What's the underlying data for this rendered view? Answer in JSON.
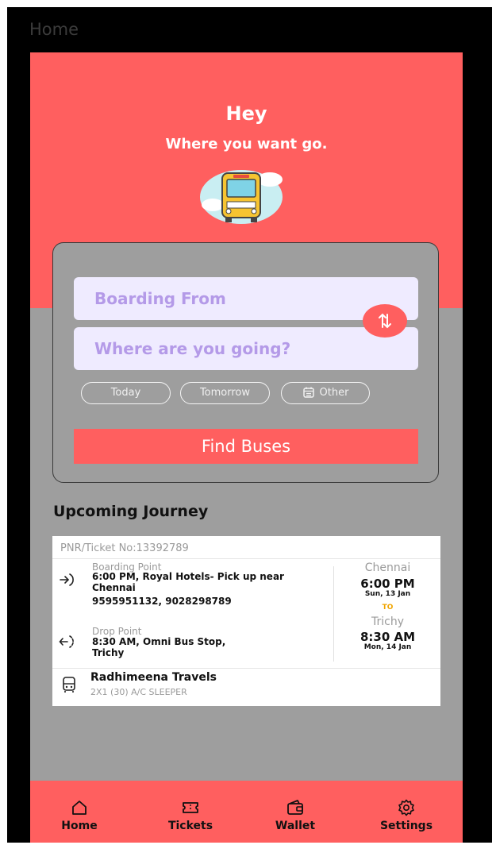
{
  "app": {
    "title": "Home"
  },
  "hero": {
    "title": "Hey",
    "subtitle": "Where you want go."
  },
  "search": {
    "boarding_placeholder": "Boarding From",
    "destination_placeholder": "Where are you going?",
    "date_options": [
      "Today",
      "Tomorrow",
      "Other"
    ],
    "find_button": "Find Buses"
  },
  "upcoming": {
    "heading": "Upcoming Journey",
    "pnr": "PNR/Ticket No:13392789",
    "boarding": {
      "label": "Boarding Point",
      "line1": "6:00 PM, Royal Hotels- Pick up near",
      "line2": "Chennai",
      "phones": "9595951132, 9028298789"
    },
    "drop": {
      "label": "Drop Point",
      "line1": "8:30 AM, Omni Bus Stop,",
      "line2": "Trichy"
    },
    "from": {
      "city": "Chennai",
      "time": "6:00 PM",
      "date": "Sun, 13 Jan"
    },
    "to_label": "TO",
    "to": {
      "city": "Trichy",
      "time": "8:30 AM",
      "date": "Mon, 14 Jan"
    },
    "operator": {
      "name": "Radhimeena Travels",
      "bus_type": "2X1 (30) A/C SLEEPER"
    }
  },
  "nav": {
    "items": [
      {
        "label": "Home",
        "icon": "home-icon"
      },
      {
        "label": "Tickets",
        "icon": "ticket-icon"
      },
      {
        "label": "Wallet",
        "icon": "wallet-icon"
      },
      {
        "label": "Settings",
        "icon": "settings-icon"
      }
    ]
  },
  "colors": {
    "accent": "#ff5f5f",
    "background": "#9e9e9e",
    "input_bg": "#efebff",
    "placeholder": "#b49ae8",
    "to_label": "#f0a500"
  }
}
